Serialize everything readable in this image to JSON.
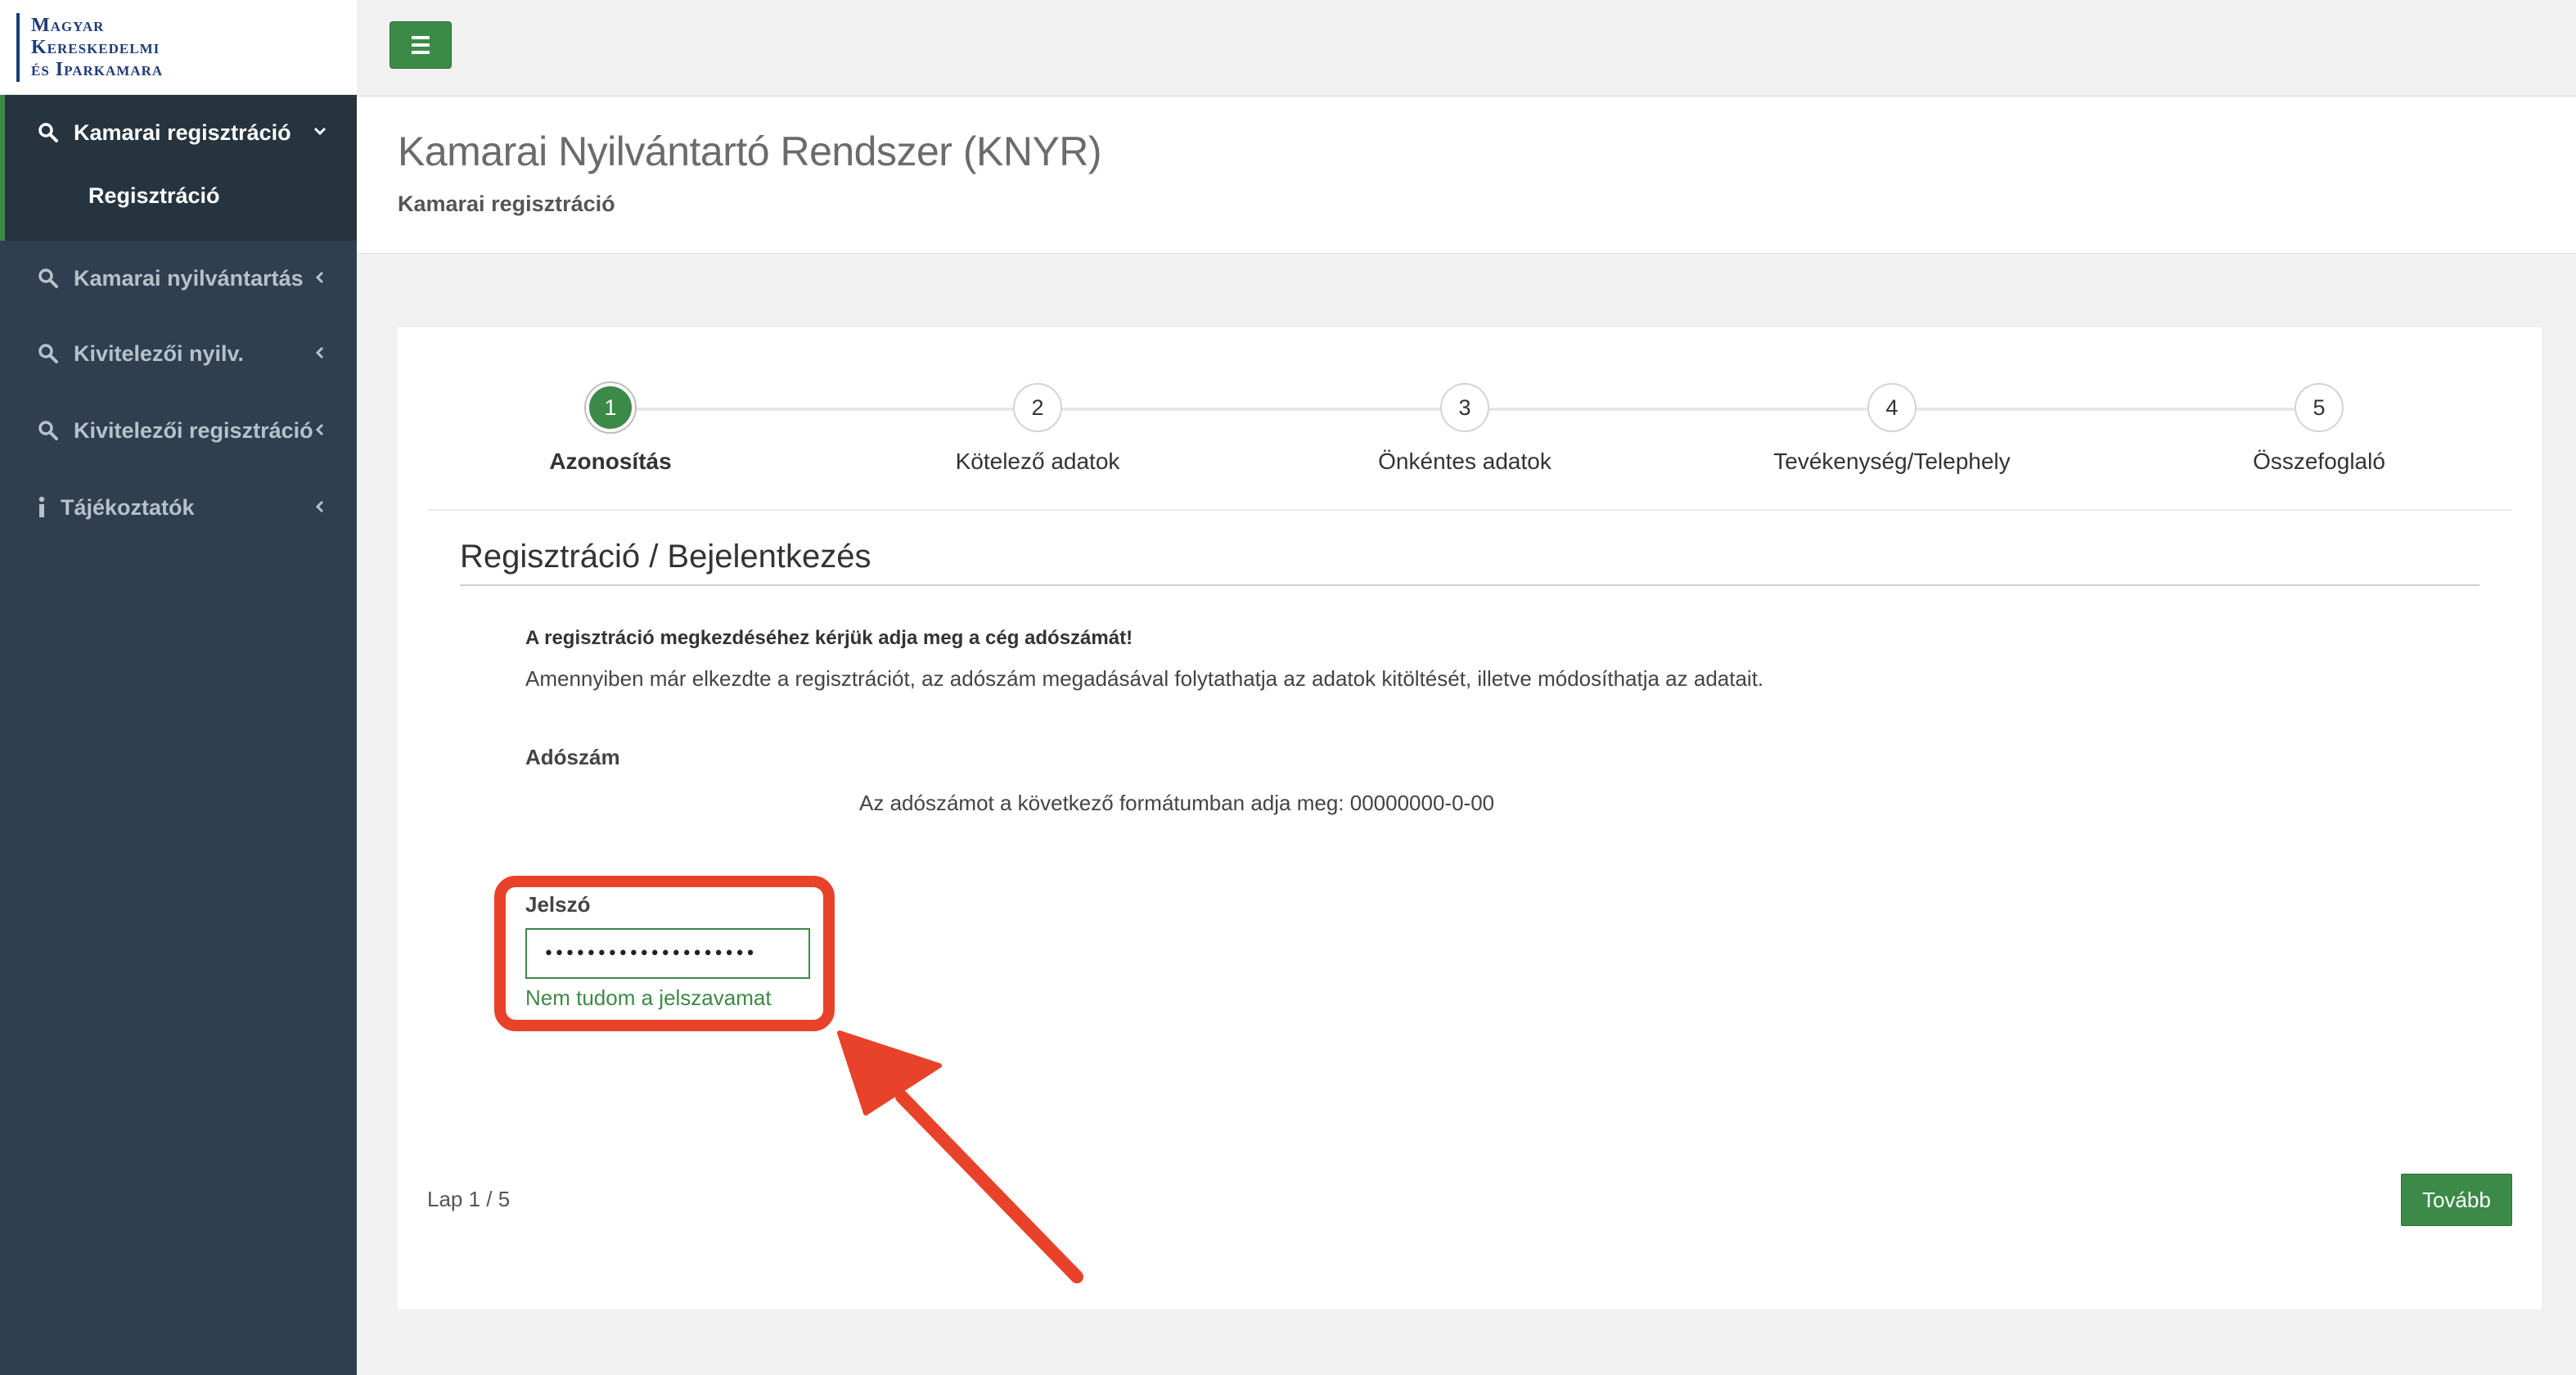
{
  "logo": {
    "lines": [
      "Magyar",
      "Kereskedelmi",
      "és Iparkamara"
    ]
  },
  "sidebar": {
    "items": [
      {
        "label": "Kamarai regisztráció",
        "icon": "search-icon",
        "chevron": "˅",
        "active": true
      },
      {
        "label": "Kamarai nyilvántartás",
        "icon": "search-icon",
        "chevron": "‹"
      },
      {
        "label": "Kivitelezői nyilv.",
        "icon": "search-icon",
        "chevron": "‹"
      },
      {
        "label": "Kivitelezői regisztráció",
        "icon": "search-icon",
        "chevron": "‹"
      },
      {
        "label": "Tájékoztatók",
        "icon": "info-icon",
        "chevron": "‹"
      }
    ],
    "subitem": "Regisztráció"
  },
  "header": {
    "title": "Kamarai Nyilvántartó Rendszer (KNYR)",
    "subtitle": "Kamarai regisztráció"
  },
  "wizard": {
    "steps": [
      {
        "num": "1",
        "label": "Azonosítás",
        "active": true
      },
      {
        "num": "2",
        "label": "Kötelező adatok"
      },
      {
        "num": "3",
        "label": "Önkéntes adatok"
      },
      {
        "num": "4",
        "label": "Tevékenység/Telephely"
      },
      {
        "num": "5",
        "label": "Összefoglaló"
      }
    ]
  },
  "form": {
    "section_title": "Regisztráció / Bejelentkezés",
    "intro_bold": "A regisztráció megkezdéséhez kérjük adja meg a cég adószámát!",
    "intro_text": "Amennyiben már elkezdte a regisztrációt, az adószám megadásával folytathatja az adatok kitöltését, illetve módosíthatja az adatait.",
    "tax_label": "Adószám",
    "tax_hint": "Az adószámot a következő formátumban adja meg: 00000000-0-00",
    "password_label": "Jelszó",
    "password_value": "••••••••••••••••••••",
    "forgot_link": "Nem tudom a jelszavamat"
  },
  "footer": {
    "page_counter": "Lap 1 / 5",
    "next_label": "Tovább"
  },
  "colors": {
    "sidebar_bg": "#2f3f50",
    "accent_green": "#3c8a47",
    "annotation_red": "#e8432a"
  }
}
